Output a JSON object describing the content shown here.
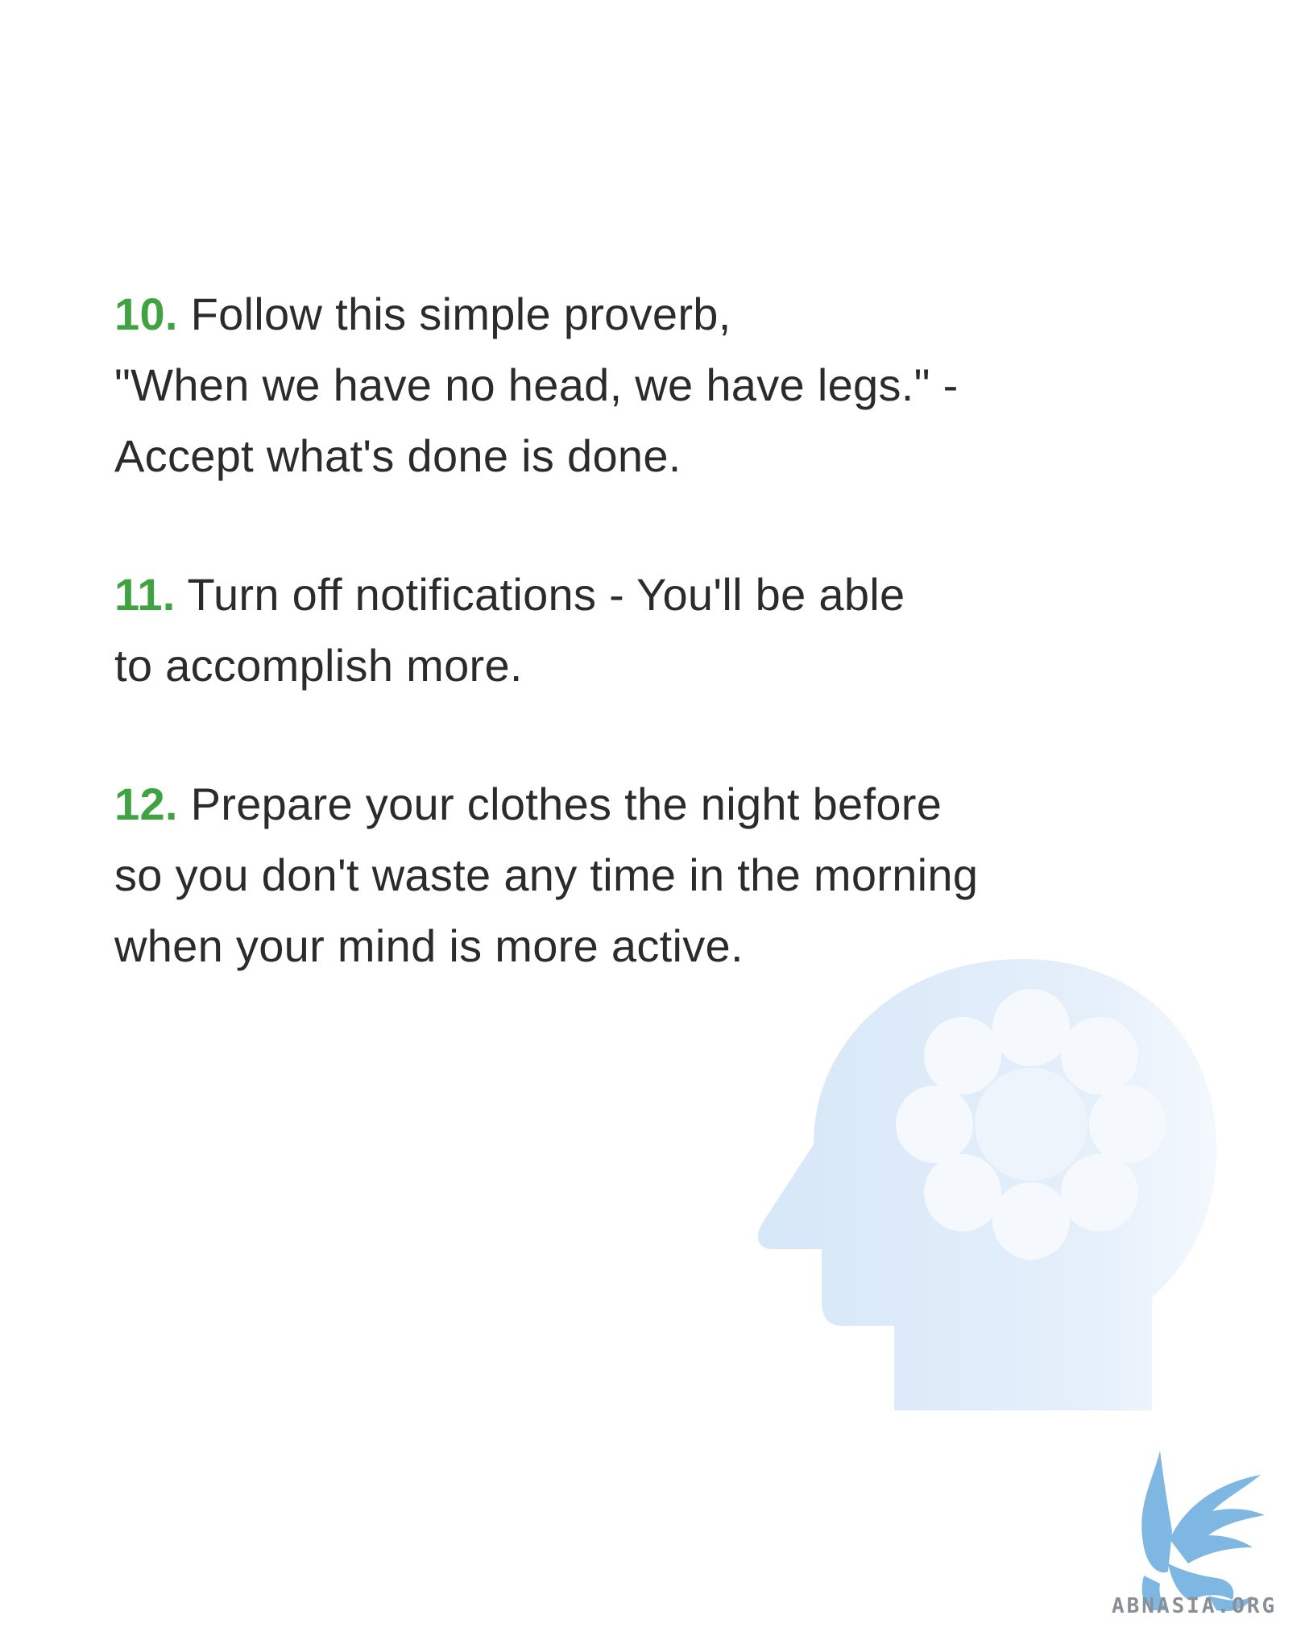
{
  "colors": {
    "number_accent": "#3fa342",
    "body_text": "#2b2b2b",
    "illustration": "#dcebfa",
    "logo_blue": "#7fb7e3"
  },
  "tips": [
    {
      "number": "10.",
      "lines": [
        "Follow this simple proverb,",
        "\"When we have no head, we have legs.\" -",
        "Accept what's done is done."
      ]
    },
    {
      "number": "11.",
      "lines": [
        "Turn off notifications - You'll be able",
        "to accomplish more."
      ]
    },
    {
      "number": "12.",
      "lines": [
        "Prepare your clothes the night before",
        "so you don't waste any time in the morning",
        "when your mind is more active."
      ]
    }
  ],
  "illustration": {
    "icon": "head-with-flower-icon"
  },
  "watermark": {
    "icon": "griffin-logo-icon",
    "text": "ABNASIA.ORG"
  }
}
